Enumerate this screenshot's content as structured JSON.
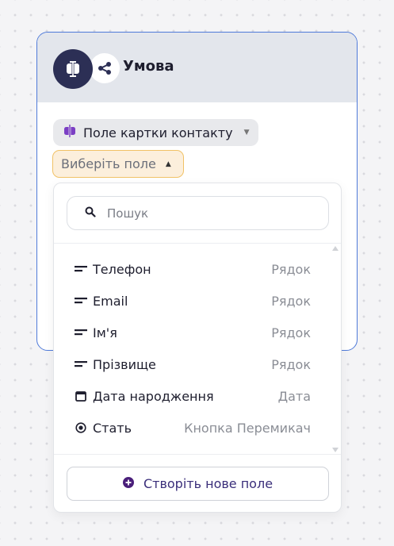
{
  "node": {
    "title": "Умова",
    "icon": "text-cursor-icon",
    "sub_icon": "share-icon"
  },
  "field_source": {
    "label": "Поле картки контакту",
    "icon": "contact-card-icon"
  },
  "field_select": {
    "label": "Виберіть поле"
  },
  "dropdown": {
    "search_placeholder": "Пошук",
    "items": [
      {
        "label": "Телефон",
        "type": "Рядок",
        "icon": "text-lines-icon"
      },
      {
        "label": "Email",
        "type": "Рядок",
        "icon": "text-lines-icon"
      },
      {
        "label": "Ім'я",
        "type": "Рядок",
        "icon": "text-lines-icon"
      },
      {
        "label": "Прізвище",
        "type": "Рядок",
        "icon": "text-lines-icon"
      },
      {
        "label": "Дата народження",
        "type": "Дата",
        "icon": "calendar-icon"
      },
      {
        "label": "Стать",
        "type": "Кнопка Перемикач",
        "icon": "radio-icon"
      }
    ],
    "create_label": "Створіть нове поле"
  },
  "colors": {
    "node_border": "#4f7ad9",
    "accent_purple": "#7b3fc4",
    "dark_navy": "#2c2f55",
    "select_border": "#f1c266"
  }
}
